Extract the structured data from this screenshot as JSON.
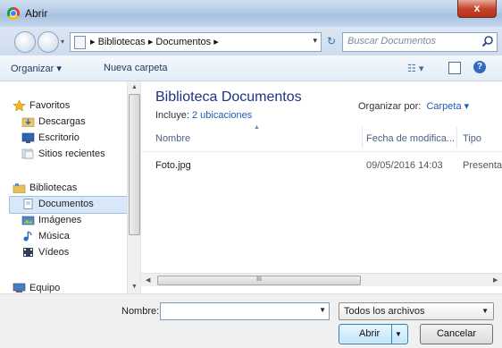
{
  "window": {
    "title": "Abrir",
    "close_glyph": "x"
  },
  "nav": {
    "breadcrumb": "▸  Bibliotecas  ▸  Documentos  ▸",
    "search_placeholder": "Buscar Documentos"
  },
  "toolbar": {
    "organize_label": "Organizar ▾",
    "new_folder_label": "Nueva carpeta"
  },
  "sidebar": {
    "items": [
      {
        "label": "Favoritos",
        "icon": "star-icon"
      },
      {
        "label": "Descargas",
        "icon": "downloads-folder-icon"
      },
      {
        "label": "Escritorio",
        "icon": "desktop-icon"
      },
      {
        "label": "Sitios recientes",
        "icon": "recent-places-icon"
      },
      {
        "label": "Bibliotecas",
        "icon": "libraries-icon"
      },
      {
        "label": "Documentos",
        "icon": "documents-icon",
        "selected": true
      },
      {
        "label": "Imágenes",
        "icon": "pictures-icon"
      },
      {
        "label": "Música",
        "icon": "music-icon"
      },
      {
        "label": "Vídeos",
        "icon": "videos-icon"
      },
      {
        "label": "Equipo",
        "icon": "computer-icon"
      }
    ]
  },
  "library": {
    "title": "Biblioteca Documentos",
    "includes_prefix": "Incluye:",
    "includes_link": "2 ubicaciones",
    "arrange_label": "Organizar por:",
    "arrange_value": "Carpeta ▾"
  },
  "columns": {
    "name": "Nombre",
    "date": "Fecha de modifica...",
    "type": "Tipo"
  },
  "files": [
    {
      "name": "Foto.jpg",
      "date": "09/05/2016 14:03",
      "type": "Presentac"
    }
  ],
  "hscroll_grip": "III",
  "bottom": {
    "name_label": "Nombre:",
    "name_value": "",
    "filetype_value": "Todos los archivos",
    "open_label": "Abrir",
    "cancel_label": "Cancelar"
  },
  "colors": {
    "title_blue": "#1e3287",
    "link_blue": "#1c5fb4",
    "selection": "#d9e8f9"
  }
}
